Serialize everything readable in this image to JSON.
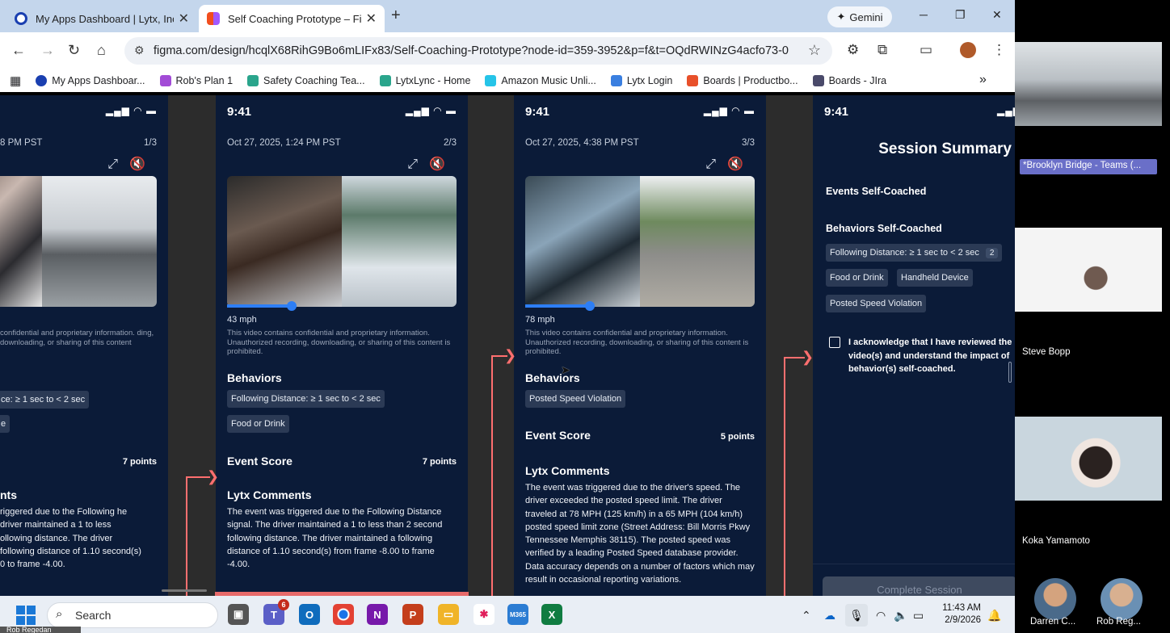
{
  "browser": {
    "tabs": [
      {
        "title": "My Apps Dashboard | Lytx, Inc.",
        "active": false,
        "icon_color": "#1a3fb0"
      },
      {
        "title": "Self Coaching Prototype – Figm",
        "active": true,
        "icon_color": "#f24e1e"
      }
    ],
    "new_tab": "+",
    "gemini_label": "Gemini",
    "url": "figma.com/design/hcqlX68RihG9Bo6mLIFx83/Self-Coaching-Prototype?node-id=359-3952&p=f&t=OQdRWINzG4acfo73-0",
    "bookmarks": [
      {
        "label": "My Apps Dashboar...",
        "color": "#1a3fb0"
      },
      {
        "label": "Rob's Plan 1",
        "color": "#a24bd6"
      },
      {
        "label": "Safety Coaching Tea...",
        "color": "#2aa58c"
      },
      {
        "label": "LytxLync - Home",
        "color": "#2aa58c"
      },
      {
        "label": "Amazon Music Unli...",
        "color": "#25c4e8"
      },
      {
        "label": "Lytx Login",
        "color": "#3a7fe0"
      },
      {
        "label": "Boards | Productbo...",
        "color": "#e8502a"
      },
      {
        "label": "Boards - JIra",
        "color": "#4a4a6a"
      }
    ],
    "bookmarks_more": "»"
  },
  "phones": [
    {
      "time": "",
      "date": "8 PM PST",
      "counter": "1/3",
      "speed": "",
      "disclaimer": "confidential and proprietary information. ding, downloading, or sharing of this content",
      "behaviors_title": "",
      "chips": [
        "ce: ≥ 1 sec to < 2 sec",
        "e"
      ],
      "score_title": "",
      "points": "7 points",
      "comments_title": "nts",
      "comments": "riggered due to the Following he driver maintained a 1 to less ollowing distance. The driver following distance of 1.10 second(s) 0 to frame -4.00."
    },
    {
      "time": "9:41",
      "date": "Oct 27, 2025, 1:24 PM PST",
      "counter": "2/3",
      "speed": "43 mph",
      "disclaimer": "This video contains confidential and proprietary information. Unauthorized recording, downloading, or sharing of this content is prohibited.",
      "behaviors_title": "Behaviors",
      "chips": [
        "Following Distance: ≥ 1 sec to < 2 sec",
        "Food or Drink"
      ],
      "score_title": "Event Score",
      "points": "7 points",
      "comments_title": "Lytx Comments",
      "comments": "The event was triggered due to the Following Distance signal. The driver maintained a 1 to less than 2 second following distance. The driver maintained a following distance of 1.10 second(s) from frame -8.00 to frame -4.00."
    },
    {
      "time": "9:41",
      "date": "Oct 27, 2025, 4:38 PM PST",
      "counter": "3/3",
      "speed": "78 mph",
      "disclaimer": "This video contains confidential and proprietary information. Unauthorized recording, downloading, or sharing of this content is prohibited.",
      "behaviors_title": "Behaviors",
      "chips": [
        "Posted Speed Violation"
      ],
      "score_title": "Event Score",
      "points": "5 points",
      "comments_title": "Lytx Comments",
      "comments": "The event was triggered due to the driver's speed. The driver exceeded the posted speed limit. The driver traveled at 78 MPH (125 km/h) in a 65 MPH (104 km/h) posted speed limit zone (Street Address: Bill Morris Pkwy Tennessee Memphis 38115). The posted speed was verified by a leading Posted Speed database provider. Data accuracy depends on a number of factors which may result in occasional reporting variations."
    }
  ],
  "summary": {
    "time": "9:41",
    "title": "Session Summary",
    "events_label": "Events Self-Coached",
    "behaviors_label": "Behaviors Self-Coached",
    "chips": [
      {
        "label": "Following Distance: ≥ 1 sec to < 2 sec",
        "count": "2"
      },
      {
        "label": "Food or Drink",
        "count": ""
      },
      {
        "label": "Handheld Device",
        "count": ""
      },
      {
        "label": "Posted Speed Violation",
        "count": ""
      }
    ],
    "ack_text": "I acknowledge that I have reviewed the video(s) and understand the impact of behavior(s) self-coached.",
    "button": "Complete Session"
  },
  "teams": {
    "meeting_label": "*Brooklyn Bridge - Teams (...",
    "participants": [
      "Steve Bopp",
      "Koka Yamamoto",
      "Darren C...",
      "Rob Reg..."
    ]
  },
  "taskbar": {
    "search_placeholder": "Search",
    "teams_badge": "6",
    "time": "11:43 AM",
    "date": "2/9/2026",
    "bottom_name": "Rob Regedan"
  }
}
